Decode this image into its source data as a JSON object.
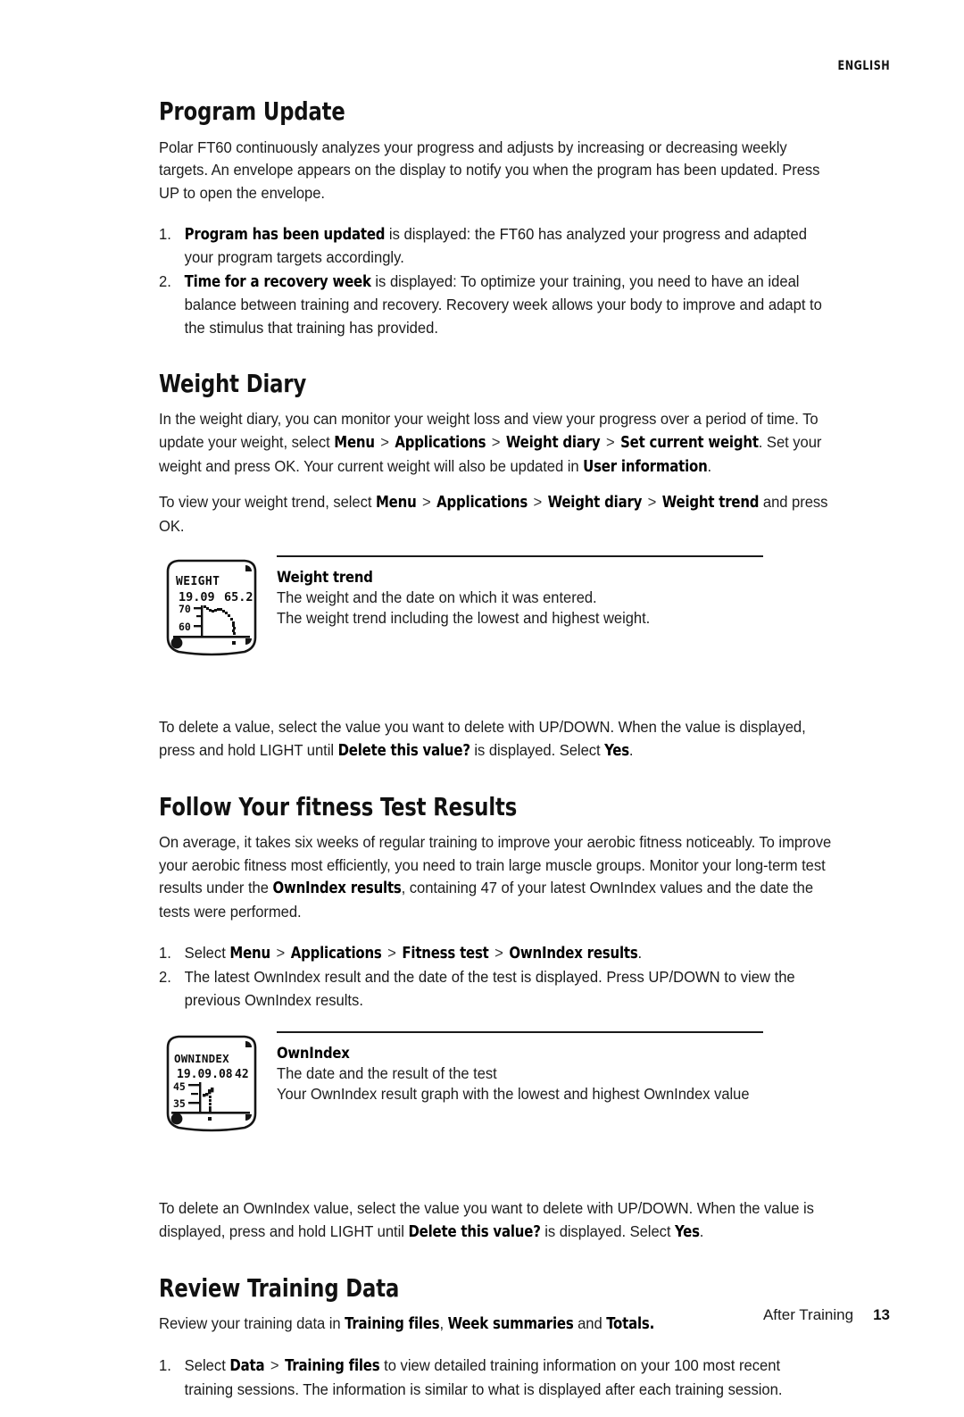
{
  "header": {
    "running_head": "ENGLISH"
  },
  "sections": [
    {
      "id": "program-update",
      "heading": "Program Update",
      "intro": "Polar FT60 continuously analyzes your progress and adjusts by increasing or decreasing weekly targets. An envelope appears on the display to notify you when the program has been updated. Press UP to open the envelope.",
      "steps": [
        {
          "number": "1.",
          "ui_lead": "Program has been updated",
          "text": " is displayed: the FT60 has analyzed your progress and adapted your program targets accordingly."
        },
        {
          "number": "2.",
          "ui_lead": "Time for a recovery week",
          "text": " is displayed: To optimize your training, you need to have an ideal balance between training and recovery. Recovery week allows your body to improve and adapt to the stimulus that training has provided."
        }
      ]
    },
    {
      "id": "weight-diary",
      "heading": "Weight Diary",
      "para1_a": "In the weight diary, you can monitor your weight loss and view your progress over a period of time. To update your weight, select ",
      "path1": [
        "Menu",
        "Applications",
        "Weight diary",
        "Set current weight"
      ],
      "para1_b": ". Set your weight and press OK. Your current weight will also be updated in ",
      "para1_ui": "User information",
      "para1_c": ".",
      "para2_a": "To view your weight trend, select ",
      "path2": [
        "Menu",
        "Applications",
        "Weight diary",
        "Weight trend"
      ],
      "para2_b": " and press OK.",
      "figure": {
        "caption_title": "Weight trend",
        "caption_lines": [
          "The weight and the date on which it was entered.",
          "The weight trend including the lowest and highest weight."
        ],
        "display": {
          "label": "WEIGHT",
          "date": "19.09",
          "value": "65.2",
          "axis_high": "70",
          "axis_low": "60"
        }
      },
      "delete_note_a": "To delete a value, select the value you want to delete with  UP/DOWN. When the value is displayed, press and hold LIGHT until ",
      "delete_note_ui1": "Delete this value?",
      "delete_note_b": " is displayed. Select ",
      "delete_note_ui2": "Yes",
      "delete_note_c": "."
    },
    {
      "id": "fitness-test-results",
      "heading": "Follow Your fitness Test Results",
      "intro_a": "On average, it takes six weeks of regular training to improve your aerobic fitness noticeably. To improve your aerobic fitness most efficiently, you need to train large muscle groups. Monitor your long-term test results under the ",
      "intro_ui": "OwnIndex results",
      "intro_b": ", containing 47 of your latest OwnIndex values and the date the tests were performed.",
      "steps": [
        {
          "number": "1.",
          "prefix": "Select ",
          "path": [
            "Menu",
            "Applications",
            "Fitness test",
            "OwnIndex results"
          ],
          "suffix": "."
        },
        {
          "number": "2.",
          "text": "The latest OwnIndex result and the date of the test is displayed. Press UP/DOWN to view the previous OwnIndex results."
        }
      ],
      "figure": {
        "caption_title": "OwnIndex",
        "caption_lines": [
          "The date and the result of the test",
          "Your OwnIndex result graph with the lowest and highest OwnIndex value"
        ],
        "display": {
          "label": "OWNINDEX",
          "date": "19.09.08",
          "value": "42",
          "axis_high": "45",
          "axis_low": "35"
        }
      },
      "delete_note_a": "To delete an OwnIndex value, select the value you want to delete with  UP/DOWN. When the value is displayed, press and hold LIGHT until ",
      "delete_note_ui1": "Delete this value?",
      "delete_note_b": " is displayed. Select ",
      "delete_note_ui2": "Yes",
      "delete_note_c": "."
    },
    {
      "id": "review-training-data",
      "heading": "Review Training Data",
      "intro_a": "Review your training data in ",
      "intro_ui1": "Training files",
      "intro_b": ", ",
      "intro_ui2": "Week summaries",
      "intro_c": " and ",
      "intro_ui3": "Totals.",
      "steps": [
        {
          "number": "1.",
          "prefix": "Select ",
          "path": [
            "Data",
            "Training files"
          ],
          "suffix": " to view detailed training information on your 100 most recent training sessions. The information is similar to what is displayed after each training session."
        }
      ]
    }
  ],
  "footer": {
    "chapter": "After Training",
    "page_number": "13"
  },
  "colors": {
    "text": "#1a1a1a",
    "rule": "#1a1a1a",
    "page_bg": "#ffffff"
  }
}
